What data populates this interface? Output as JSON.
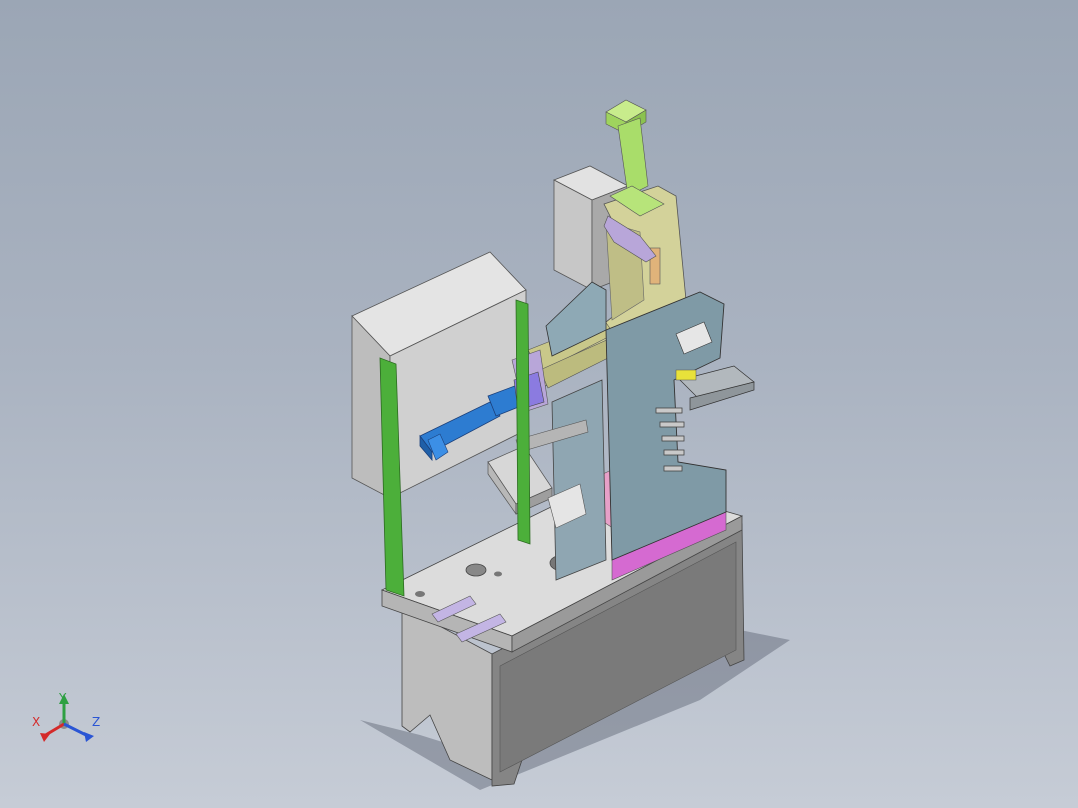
{
  "view": {
    "background_top": "#9ba6b5",
    "background_bottom": "#c6ccd6"
  },
  "triad": {
    "x_label": "X",
    "y_label": "Y",
    "z_label": "Z",
    "x_color": "#d42a2a",
    "y_color": "#2ea043",
    "z_color": "#2a55d4"
  },
  "model": {
    "parts": [
      {
        "name": "base-cabinet",
        "color": "#8e8e8e"
      },
      {
        "name": "table-top",
        "color": "#d7d7d7"
      },
      {
        "name": "electrical-box-left",
        "color": "#cfcfcf"
      },
      {
        "name": "electrical-box-rear",
        "color": "#cfcfcf"
      },
      {
        "name": "side-plate-right",
        "color": "#7f9aa6"
      },
      {
        "name": "c-frame",
        "color": "#c9c88a"
      },
      {
        "name": "vertical-cylinder",
        "color": "#a9dd6a"
      },
      {
        "name": "horizontal-cylinder",
        "color": "#2d7cd1"
      },
      {
        "name": "green-posts",
        "color": "#4caf3a"
      },
      {
        "name": "pink-plate",
        "color": "#d96fd0"
      },
      {
        "name": "lavender-blocks",
        "color": "#b8a6d9"
      }
    ]
  }
}
